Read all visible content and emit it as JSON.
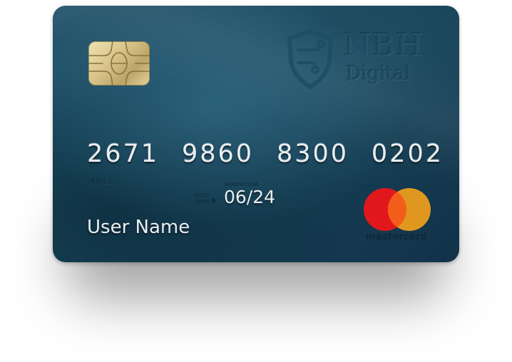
{
  "card": {
    "brand_title": "NBH",
    "brand_subtitle": "Digital",
    "number_groups": [
      "2671",
      "9860",
      "8300",
      "0202"
    ],
    "small_code": "4841",
    "good_thru_label": "GOOD THRU",
    "month_year_label": "MONTH/YEAR",
    "expiry": "06/24",
    "holder_name": "User Name",
    "network_name": "mastercard",
    "colors": {
      "card_base": "#1a4a60",
      "mastercard_red": "#e0181b",
      "mastercard_yellow": "#f2a01c",
      "chip_gold": "#d8c48a"
    },
    "icons": [
      "chip-icon",
      "shield-logo-icon",
      "mastercard-logo-icon"
    ]
  }
}
